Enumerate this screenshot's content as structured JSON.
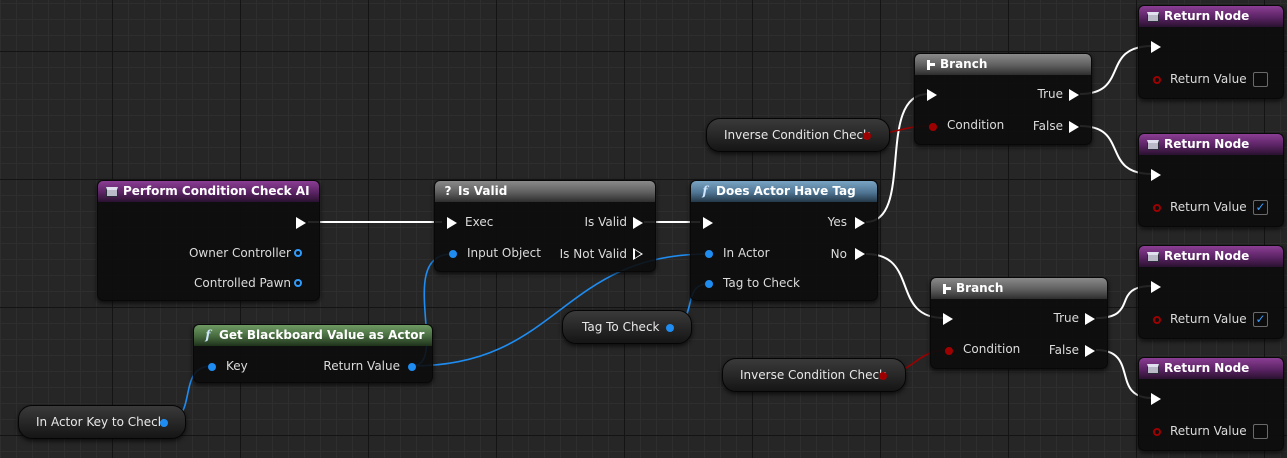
{
  "nodes": {
    "perform": {
      "title": "Perform Condition Check AI",
      "owner": "Owner Controller",
      "pawn": "Controlled Pawn"
    },
    "blackboard": {
      "title": "Get Blackboard Value as Actor",
      "key": "Key",
      "ret": "Return Value"
    },
    "isvalid": {
      "title": "Is Valid",
      "exec": "Exec",
      "input": "Input Object",
      "valid": "Is Valid",
      "notvalid": "Is Not Valid"
    },
    "hastag": {
      "title": "Does Actor Have Tag",
      "in_actor": "In Actor",
      "tag": "Tag to Check",
      "yes": "Yes",
      "no": "No"
    },
    "branch1": {
      "title": "Branch",
      "condition": "Condition",
      "true": "True",
      "false": "False"
    },
    "branch2": {
      "title": "Branch",
      "condition": "Condition",
      "true": "True",
      "false": "False"
    },
    "ret1": {
      "title": "Return Node",
      "value": "Return Value",
      "checked": false
    },
    "ret2": {
      "title": "Return Node",
      "value": "Return Value",
      "checked": true
    },
    "ret3": {
      "title": "Return Node",
      "value": "Return Value",
      "checked": true
    },
    "ret4": {
      "title": "Return Node",
      "value": "Return Value",
      "checked": false
    }
  },
  "variables": {
    "in_actor_key": "In Actor Key to Check",
    "tag_to_check": "Tag To Check",
    "inverse1": "Inverse Condition Check",
    "inverse2": "Inverse Condition Check"
  },
  "icons": {
    "function": "function-f-icon",
    "macro": "question-mark-icon",
    "branch": "branch-icon",
    "event": "event-box-icon"
  },
  "colors": {
    "exec_wire": "#ffffff",
    "object_wire": "#1e8cf0",
    "bool_wire": "#9b0000",
    "check": "#3b9cff"
  }
}
